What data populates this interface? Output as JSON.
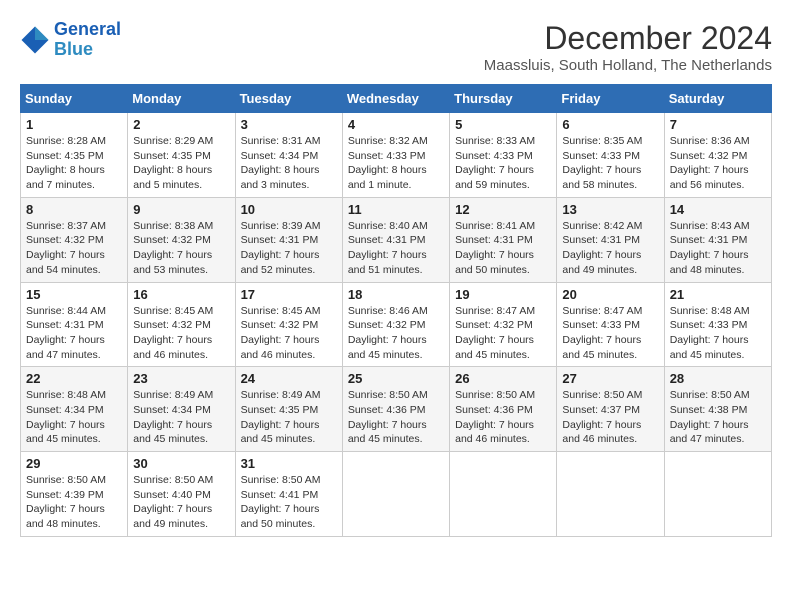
{
  "header": {
    "logo_line1": "General",
    "logo_line2": "Blue",
    "title": "December 2024",
    "subtitle": "Maassluis, South Holland, The Netherlands"
  },
  "weekdays": [
    "Sunday",
    "Monday",
    "Tuesday",
    "Wednesday",
    "Thursday",
    "Friday",
    "Saturday"
  ],
  "weeks": [
    [
      {
        "day": "1",
        "sunrise": "Sunrise: 8:28 AM",
        "sunset": "Sunset: 4:35 PM",
        "daylight": "Daylight: 8 hours and 7 minutes."
      },
      {
        "day": "2",
        "sunrise": "Sunrise: 8:29 AM",
        "sunset": "Sunset: 4:35 PM",
        "daylight": "Daylight: 8 hours and 5 minutes."
      },
      {
        "day": "3",
        "sunrise": "Sunrise: 8:31 AM",
        "sunset": "Sunset: 4:34 PM",
        "daylight": "Daylight: 8 hours and 3 minutes."
      },
      {
        "day": "4",
        "sunrise": "Sunrise: 8:32 AM",
        "sunset": "Sunset: 4:33 PM",
        "daylight": "Daylight: 8 hours and 1 minute."
      },
      {
        "day": "5",
        "sunrise": "Sunrise: 8:33 AM",
        "sunset": "Sunset: 4:33 PM",
        "daylight": "Daylight: 7 hours and 59 minutes."
      },
      {
        "day": "6",
        "sunrise": "Sunrise: 8:35 AM",
        "sunset": "Sunset: 4:33 PM",
        "daylight": "Daylight: 7 hours and 58 minutes."
      },
      {
        "day": "7",
        "sunrise": "Sunrise: 8:36 AM",
        "sunset": "Sunset: 4:32 PM",
        "daylight": "Daylight: 7 hours and 56 minutes."
      }
    ],
    [
      {
        "day": "8",
        "sunrise": "Sunrise: 8:37 AM",
        "sunset": "Sunset: 4:32 PM",
        "daylight": "Daylight: 7 hours and 54 minutes."
      },
      {
        "day": "9",
        "sunrise": "Sunrise: 8:38 AM",
        "sunset": "Sunset: 4:32 PM",
        "daylight": "Daylight: 7 hours and 53 minutes."
      },
      {
        "day": "10",
        "sunrise": "Sunrise: 8:39 AM",
        "sunset": "Sunset: 4:31 PM",
        "daylight": "Daylight: 7 hours and 52 minutes."
      },
      {
        "day": "11",
        "sunrise": "Sunrise: 8:40 AM",
        "sunset": "Sunset: 4:31 PM",
        "daylight": "Daylight: 7 hours and 51 minutes."
      },
      {
        "day": "12",
        "sunrise": "Sunrise: 8:41 AM",
        "sunset": "Sunset: 4:31 PM",
        "daylight": "Daylight: 7 hours and 50 minutes."
      },
      {
        "day": "13",
        "sunrise": "Sunrise: 8:42 AM",
        "sunset": "Sunset: 4:31 PM",
        "daylight": "Daylight: 7 hours and 49 minutes."
      },
      {
        "day": "14",
        "sunrise": "Sunrise: 8:43 AM",
        "sunset": "Sunset: 4:31 PM",
        "daylight": "Daylight: 7 hours and 48 minutes."
      }
    ],
    [
      {
        "day": "15",
        "sunrise": "Sunrise: 8:44 AM",
        "sunset": "Sunset: 4:31 PM",
        "daylight": "Daylight: 7 hours and 47 minutes."
      },
      {
        "day": "16",
        "sunrise": "Sunrise: 8:45 AM",
        "sunset": "Sunset: 4:32 PM",
        "daylight": "Daylight: 7 hours and 46 minutes."
      },
      {
        "day": "17",
        "sunrise": "Sunrise: 8:45 AM",
        "sunset": "Sunset: 4:32 PM",
        "daylight": "Daylight: 7 hours and 46 minutes."
      },
      {
        "day": "18",
        "sunrise": "Sunrise: 8:46 AM",
        "sunset": "Sunset: 4:32 PM",
        "daylight": "Daylight: 7 hours and 45 minutes."
      },
      {
        "day": "19",
        "sunrise": "Sunrise: 8:47 AM",
        "sunset": "Sunset: 4:32 PM",
        "daylight": "Daylight: 7 hours and 45 minutes."
      },
      {
        "day": "20",
        "sunrise": "Sunrise: 8:47 AM",
        "sunset": "Sunset: 4:33 PM",
        "daylight": "Daylight: 7 hours and 45 minutes."
      },
      {
        "day": "21",
        "sunrise": "Sunrise: 8:48 AM",
        "sunset": "Sunset: 4:33 PM",
        "daylight": "Daylight: 7 hours and 45 minutes."
      }
    ],
    [
      {
        "day": "22",
        "sunrise": "Sunrise: 8:48 AM",
        "sunset": "Sunset: 4:34 PM",
        "daylight": "Daylight: 7 hours and 45 minutes."
      },
      {
        "day": "23",
        "sunrise": "Sunrise: 8:49 AM",
        "sunset": "Sunset: 4:34 PM",
        "daylight": "Daylight: 7 hours and 45 minutes."
      },
      {
        "day": "24",
        "sunrise": "Sunrise: 8:49 AM",
        "sunset": "Sunset: 4:35 PM",
        "daylight": "Daylight: 7 hours and 45 minutes."
      },
      {
        "day": "25",
        "sunrise": "Sunrise: 8:50 AM",
        "sunset": "Sunset: 4:36 PM",
        "daylight": "Daylight: 7 hours and 45 minutes."
      },
      {
        "day": "26",
        "sunrise": "Sunrise: 8:50 AM",
        "sunset": "Sunset: 4:36 PM",
        "daylight": "Daylight: 7 hours and 46 minutes."
      },
      {
        "day": "27",
        "sunrise": "Sunrise: 8:50 AM",
        "sunset": "Sunset: 4:37 PM",
        "daylight": "Daylight: 7 hours and 46 minutes."
      },
      {
        "day": "28",
        "sunrise": "Sunrise: 8:50 AM",
        "sunset": "Sunset: 4:38 PM",
        "daylight": "Daylight: 7 hours and 47 minutes."
      }
    ],
    [
      {
        "day": "29",
        "sunrise": "Sunrise: 8:50 AM",
        "sunset": "Sunset: 4:39 PM",
        "daylight": "Daylight: 7 hours and 48 minutes."
      },
      {
        "day": "30",
        "sunrise": "Sunrise: 8:50 AM",
        "sunset": "Sunset: 4:40 PM",
        "daylight": "Daylight: 7 hours and 49 minutes."
      },
      {
        "day": "31",
        "sunrise": "Sunrise: 8:50 AM",
        "sunset": "Sunset: 4:41 PM",
        "daylight": "Daylight: 7 hours and 50 minutes."
      },
      null,
      null,
      null,
      null
    ]
  ]
}
